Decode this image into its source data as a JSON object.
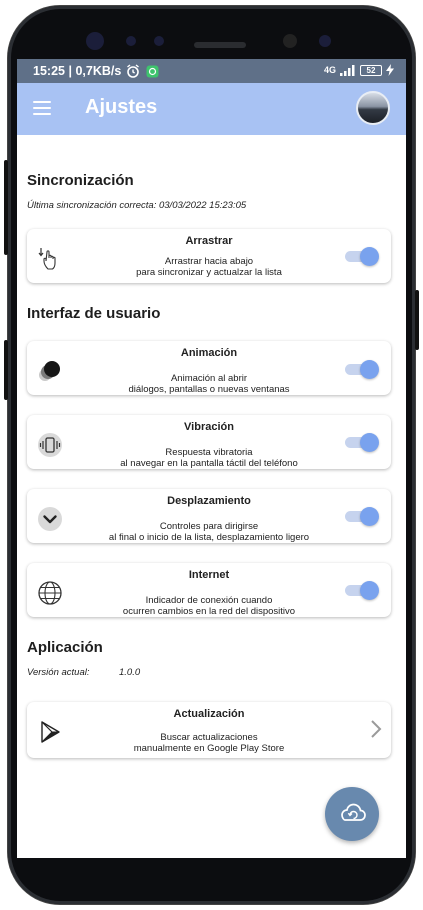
{
  "statusbar": {
    "time": "15:25",
    "speed": "0,7KB/s",
    "network": "4G",
    "battery": "52"
  },
  "appbar": {
    "title": "Ajustes"
  },
  "sections": {
    "sync": {
      "title": "Sincronización",
      "note": "Última sincronización correcta: 03/03/2022 15:23:05"
    },
    "ui": {
      "title": "Interfaz de usuario"
    },
    "app": {
      "title": "Aplicación",
      "version_label": "Versión actual:",
      "version_value": "1.0.0"
    }
  },
  "cards": {
    "drag": {
      "title": "Arrastrar",
      "desc": "Arrastrar hacia abajo\npara sincronizar y actualzar la lista",
      "enabled": true,
      "icon": "drag-down-icon"
    },
    "animation": {
      "title": "Animación",
      "desc": "Animación al abrir\ndiálogos, pantallas o nuevas ventanas",
      "enabled": true,
      "icon": "animation-icon"
    },
    "vibration": {
      "title": "Vibración",
      "desc": "Respuesta vibratoria\nal navegar en la pantalla táctil del teléfono",
      "enabled": true,
      "icon": "vibration-icon"
    },
    "scroll": {
      "title": "Desplazamiento",
      "desc": "Controles para dirigirse\nal final o inicio de la lista, desplazamiento ligero",
      "enabled": true,
      "icon": "chevron-down-circle-icon"
    },
    "internet": {
      "title": "Internet",
      "desc": "Indicador de conexión cuando\nocurren cambios en la red del dispositivo",
      "enabled": true,
      "icon": "globe-icon"
    },
    "update": {
      "title": "Actualización",
      "desc": "Buscar actualizaciones\nmanualmente en Google Play Store",
      "icon": "play-store-icon"
    }
  },
  "colors": {
    "appbar": "#a8c2f3",
    "toggle_on": "#79a2ee",
    "fab": "#6889ae"
  }
}
